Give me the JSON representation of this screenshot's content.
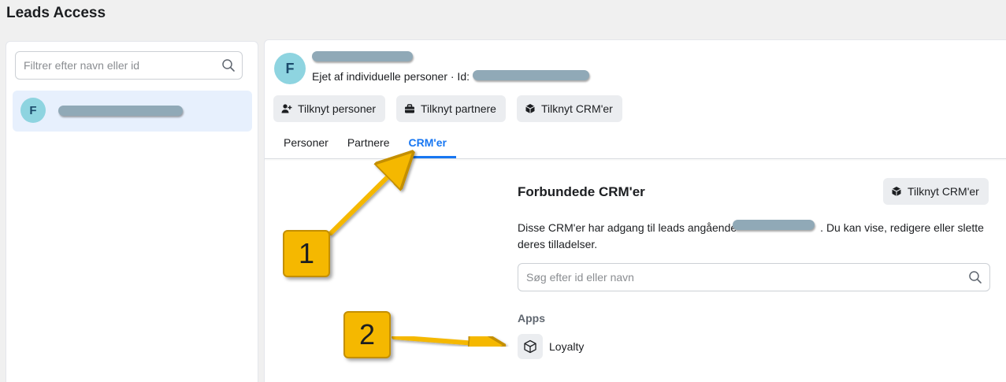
{
  "page": {
    "title": "Leads Access"
  },
  "sidebar": {
    "filter_placeholder": "Filtrer efter navn eller id",
    "items": [
      {
        "avatar_letter": "F"
      }
    ]
  },
  "header": {
    "avatar_letter": "F",
    "owner_label": "Ejet af individuelle personer · Id:"
  },
  "actions": {
    "connect_people": "Tilknyt personer",
    "connect_partners": "Tilknyt partnere",
    "connect_crms": "Tilknyt CRM'er"
  },
  "tabs": [
    {
      "label": "Personer",
      "active": false
    },
    {
      "label": "Partnere",
      "active": false
    },
    {
      "label": "CRM'er",
      "active": true
    }
  ],
  "crm_section": {
    "title": "Forbundede CRM'er",
    "connect_button": "Tilknyt CRM'er",
    "description_before": "Disse CRM'er har adgang til leads angående",
    "description_after": ". Du kan vise, redigere eller slette deres tilladelser.",
    "search_placeholder": "Søg efter id eller navn",
    "apps_label": "Apps",
    "apps": [
      {
        "name": "Loyalty",
        "icon": "cube-icon"
      }
    ]
  },
  "annotations": [
    {
      "number": "1"
    },
    {
      "number": "2"
    }
  ],
  "colors": {
    "accent": "#1877f2",
    "active_item_bg": "#e7f0fd",
    "avatar_bg": "#8ed4e0",
    "callout": "#f5b800",
    "button_bg": "#ebedf0"
  }
}
